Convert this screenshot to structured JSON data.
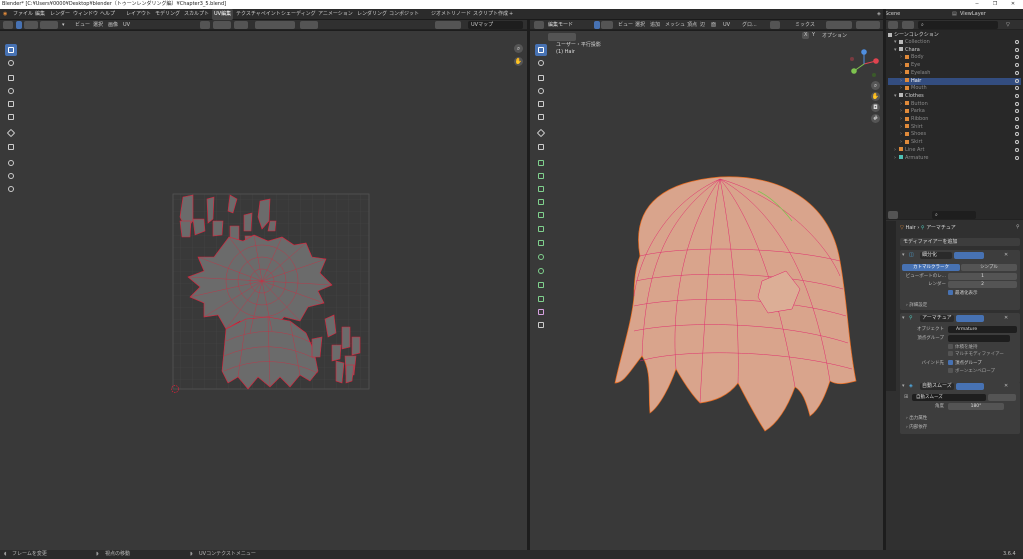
{
  "title": "Blender* [C:¥Users¥0000¥Desktop¥blender（トゥーンレンダリング編）¥Chapter3_5.blend]",
  "window_controls": [
    "─",
    "❐",
    "✕"
  ],
  "menu": [
    "ファイル",
    "編集",
    "レンダー",
    "ウィンドウ",
    "ヘルプ"
  ],
  "workspaces": [
    "レイアウト",
    "モデリング",
    "スカルプト",
    "UV編集",
    "テクスチャペイント",
    "シェーディング",
    "アニメーション",
    "レンダリング",
    "コンポジット",
    "ジオメトリノード",
    "スクリプト作成",
    "+"
  ],
  "scene": {
    "label": "Scene",
    "view_layer": "ViewLayer"
  },
  "uv_editor": {
    "menus": [
      "ビュー",
      "選択",
      "画像",
      "UV"
    ],
    "image_name": "UVマップ"
  },
  "viewport": {
    "mode": "編集モード",
    "menus": [
      "ビュー",
      "選択",
      "追加",
      "メッシュ",
      "頂点",
      "辺",
      "面",
      "UV"
    ],
    "transform": "グロ...",
    "mix": "ミックス",
    "options": "オプション",
    "xyz": [
      "X",
      "Y",
      "Z"
    ],
    "overlay_title": "ユーザー・平行投影",
    "overlay_object": "(1) Hair"
  },
  "outliner": {
    "header": "シーンコレクション",
    "rows": [
      {
        "name": "Collection",
        "indent": 1,
        "type": "coll",
        "dim": true
      },
      {
        "name": "Chara",
        "indent": 1,
        "type": "coll"
      },
      {
        "name": "Body",
        "indent": 2,
        "type": "obj",
        "dim": true
      },
      {
        "name": "Eye",
        "indent": 2,
        "type": "obj",
        "dim": true
      },
      {
        "name": "Eyelash",
        "indent": 2,
        "type": "obj",
        "dim": true
      },
      {
        "name": "Hair",
        "indent": 2,
        "type": "obj",
        "selected": true
      },
      {
        "name": "Mouth",
        "indent": 2,
        "type": "obj",
        "dim": true
      },
      {
        "name": "Clothes",
        "indent": 1,
        "type": "coll"
      },
      {
        "name": "Button",
        "indent": 2,
        "type": "obj",
        "dim": true
      },
      {
        "name": "Parka",
        "indent": 2,
        "type": "obj",
        "dim": true
      },
      {
        "name": "Ribbon",
        "indent": 2,
        "type": "obj",
        "dim": true
      },
      {
        "name": "Shirt",
        "indent": 2,
        "type": "obj",
        "dim": true
      },
      {
        "name": "Shoes",
        "indent": 2,
        "type": "obj",
        "dim": true
      },
      {
        "name": "Skirt",
        "indent": 2,
        "type": "obj",
        "dim": true
      },
      {
        "name": "Line Art",
        "indent": 1,
        "type": "obj",
        "dim": true
      },
      {
        "name": "Armature",
        "indent": 1,
        "type": "arm",
        "dim": true
      }
    ]
  },
  "properties": {
    "breadcrumb_object": "Hair",
    "breadcrumb_sep": "›",
    "breadcrumb_modifier": "アーマチュア",
    "add_modifier": "モディファイアーを追加",
    "subsurf": {
      "name": "細分化",
      "tabs": [
        "カトマルクラーク",
        "シンプル"
      ],
      "viewport_label": "ビューポートのレ...",
      "viewport_value": "1",
      "render_label": "レンダー",
      "render_value": "2",
      "optimal_label": "最適化表示",
      "advanced": "詳細設定"
    },
    "armature": {
      "name": "アーマチュア",
      "object_label": "オブジェクト",
      "object_value": "Armature",
      "vgroup_label": "頂点グループ",
      "preserve_volume": "体積を維持",
      "multi_modifier": "マルチモディファイアー",
      "bind_label": "バインド先",
      "bind_vgroups": "頂点グループ",
      "bind_envelopes": "ボーンエンベロープ"
    },
    "autosmooth": {
      "name": "自動スムーズ",
      "node_group": "自動スムーズ",
      "angle_label": "角度",
      "angle_value": "180°",
      "output_attrs": "出力属性",
      "internal_deps": "内部依存"
    }
  },
  "status": {
    "item1": "フレームを変更",
    "item2": "視点の移動",
    "item3": "UVコンテクストメニュー",
    "version": "3.6.4"
  },
  "colors": {
    "accent": "#4772b3",
    "uv_edge": "#e0213a",
    "hair": "#d9a48c",
    "hair_edge": "#e86a1e"
  }
}
